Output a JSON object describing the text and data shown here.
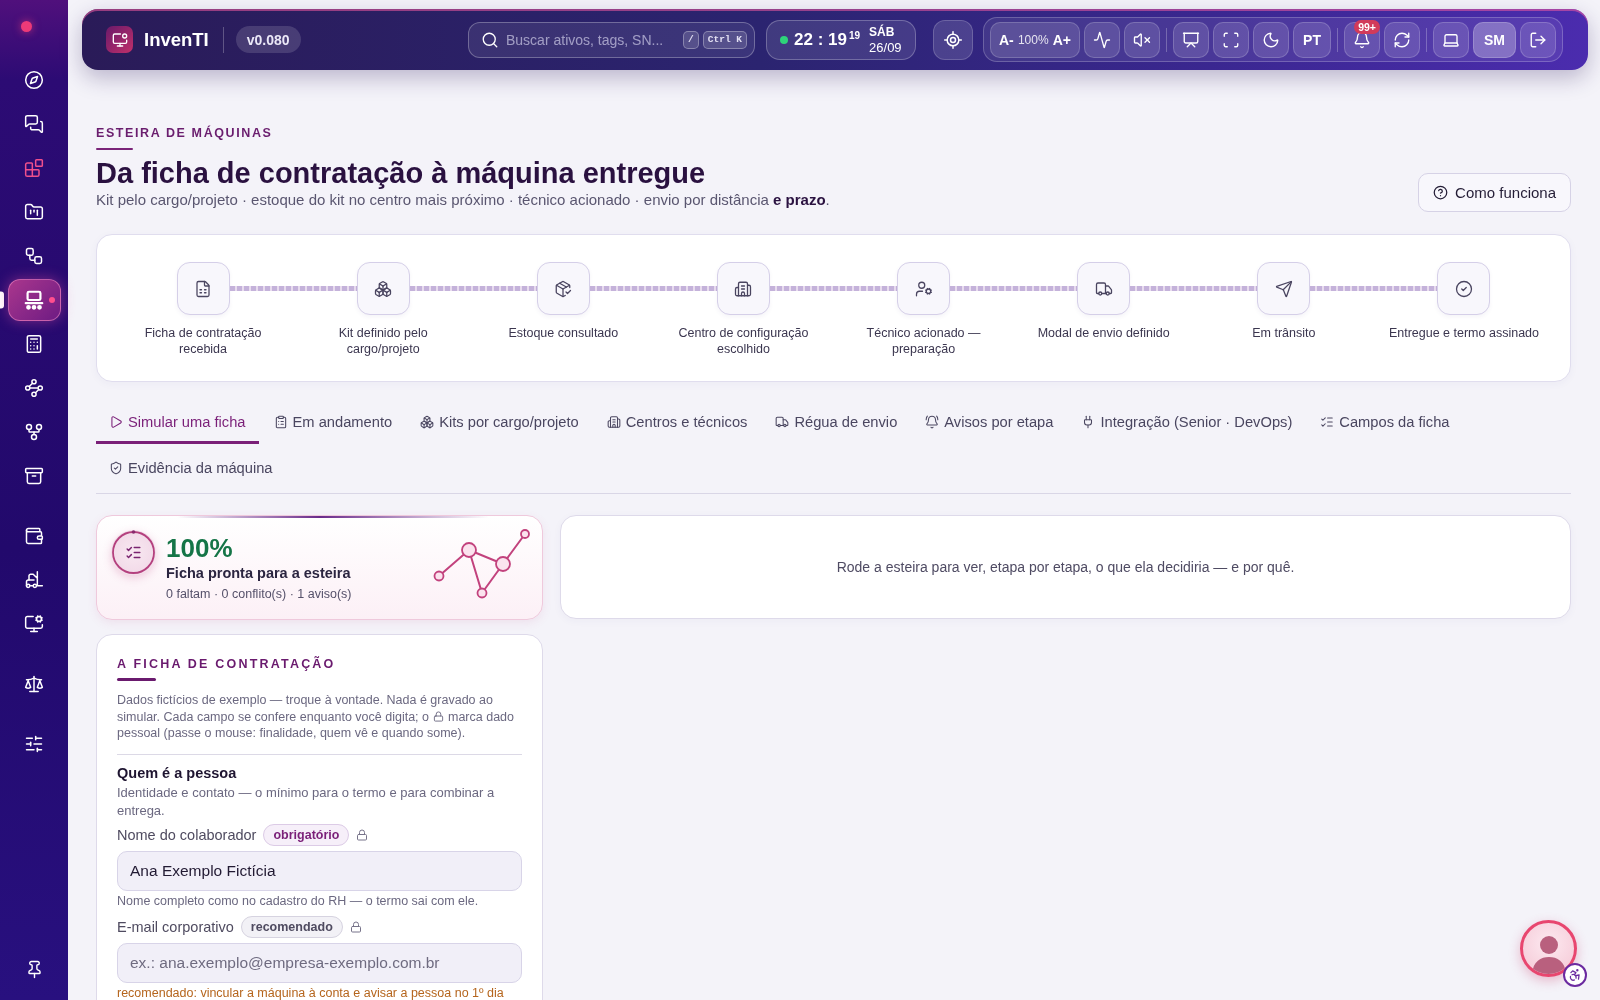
{
  "sidebar": {
    "groups": [
      {
        "items": [
          {
            "selected": false,
            "color": "#ffffff"
          },
          {
            "selected": false,
            "color": "#ffffff"
          },
          {
            "selected": false,
            "color": "#f0508c"
          },
          {
            "selected": false,
            "color": "#ffffff"
          },
          {
            "selected": false,
            "color": "#ffffff"
          },
          {
            "selected": true,
            "color": "#ffffff"
          },
          {
            "selected": false,
            "color": "#ffffff"
          },
          {
            "selected": false,
            "color": "#ffffff"
          },
          {
            "selected": false,
            "color": "#ffffff"
          },
          {
            "selected": false,
            "color": "#ffffff"
          }
        ]
      },
      {
        "items": [
          {
            "selected": false,
            "color": "#ffffff"
          },
          {
            "selected": false,
            "color": "#ffffff"
          },
          {
            "selected": false,
            "color": "#ffffff"
          }
        ]
      },
      {
        "items": [
          {
            "selected": false,
            "color": "#ffffff"
          }
        ]
      },
      {
        "items": [
          {
            "selected": false,
            "color": "#ffffff"
          }
        ]
      }
    ]
  },
  "topbar": {
    "app_name": "InvenTI",
    "version": "v0.080",
    "search": {
      "placeholder": "Buscar ativos, tags, SN...",
      "shortcuts": [
        "/",
        "Ctrl K"
      ]
    },
    "clock": {
      "online": true,
      "time": "22 : 19",
      "seconds": "19",
      "weekday": "SÁB",
      "date": "26/09"
    },
    "font_size": {
      "decrease": "A-",
      "value": "100%",
      "increase": "A+"
    },
    "language": "PT",
    "notifications": "99+",
    "user_initials": "SM"
  },
  "header": {
    "eyebrow": "ESTEIRA DE MÁQUINAS",
    "title": "Da ficha de contratação à máquina entregue",
    "subtitle": "Kit pelo cargo/projeto · estoque do kit no centro mais próximo · técnico acionado · envio por distância **e prazo**.",
    "help_button": "Como funciona"
  },
  "stepper": {
    "steps": [
      {
        "label": "Ficha de contratação recebida"
      },
      {
        "label": "Kit definido pelo cargo/projeto"
      },
      {
        "label": "Estoque consultado"
      },
      {
        "label": "Centro de configuração escolhido"
      },
      {
        "label": "Técnico acionado — preparação"
      },
      {
        "label": "Modal de envio definido"
      },
      {
        "label": "Em trânsito"
      },
      {
        "label": "Entregue e termo assinado"
      }
    ]
  },
  "tabs": [
    {
      "label": "Simular uma ficha",
      "selected": true
    },
    {
      "label": "Em andamento",
      "selected": false
    },
    {
      "label": "Kits por cargo/projeto",
      "selected": false
    },
    {
      "label": "Centros e técnicos",
      "selected": false
    },
    {
      "label": "Régua de envio",
      "selected": false
    },
    {
      "label": "Avisos por etapa",
      "selected": false
    },
    {
      "label": "Integração (Senior · DevOps)",
      "selected": false
    },
    {
      "label": "Campos da ficha",
      "selected": false
    },
    {
      "label": "Evidência da máquina",
      "selected": false
    }
  ],
  "readiness": {
    "percent": "100%",
    "title": "Ficha pronta para a esteira",
    "summary": "0 faltam · 0 conflito(s) · 1 aviso(s)"
  },
  "result_panel": {
    "message": "Rode a esteira para ver, etapa por etapa, o que ela decidiria — e por quê."
  },
  "form": {
    "title": "A FICHA DE CONTRATAÇÃO",
    "intro": [
      "Dados fictícios de exemplo — troque à vontade. Nada é gravado ao simular. Cada campo se confere enquanto você digita; o",
      "marca dado pessoal (passe o mouse: finalidade, quem vê e quando some)."
    ],
    "sections": [
      {
        "title": "Quem é a pessoa",
        "description": "Identidade e contato — o mínimo para o termo e para combinar a entrega.",
        "fields": [
          {
            "label": "Nome do colaborador",
            "tag": {
              "text": "obrigatório",
              "kind": "required"
            },
            "personal": true,
            "value": "Ana Exemplo Fictícia",
            "help": {
              "text": "Nome completo como no cadastro do RH — o termo sai com ele.",
              "kind": "info"
            }
          },
          {
            "label": "E-mail corporativo",
            "tag": {
              "text": "recomendado",
              "kind": "recommended"
            },
            "personal": true,
            "placeholder": "ex.: ana.exemplo@empresa-exemplo.com.br",
            "help": {
              "text": "recomendado: vincular a máquina à conta e avisar a pessoa no 1º dia",
              "kind": "warning"
            }
          }
        ]
      }
    ]
  }
}
